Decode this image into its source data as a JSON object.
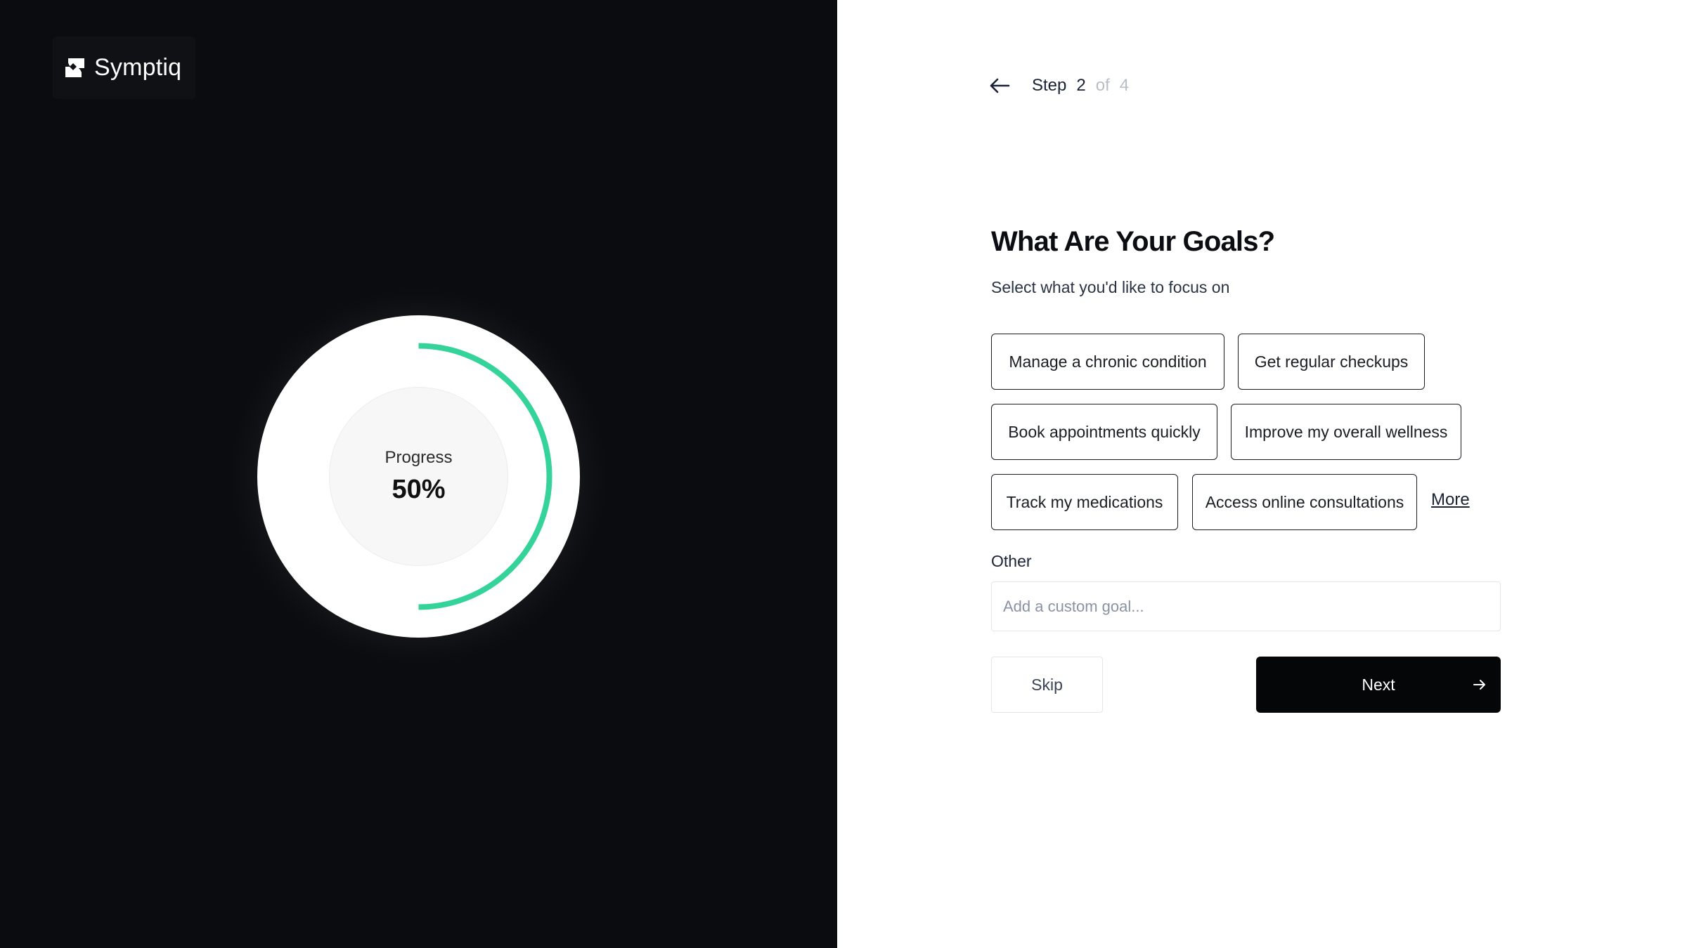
{
  "brand": {
    "name": "Symptiq"
  },
  "progress": {
    "label": "Progress",
    "value_text": "50%",
    "fraction": 0.5,
    "accent_color": "#34d399"
  },
  "stepper": {
    "word": "Step",
    "current": "2",
    "of": "of",
    "total": "4"
  },
  "form": {
    "title": "What Are Your Goals?",
    "subtitle": "Select what you'd like to focus on",
    "chips": [
      "Manage a chronic condition",
      "Get regular checkups",
      "Book appointments quickly",
      "Improve my overall wellness",
      "Track my medications",
      "Access online consultations"
    ],
    "more_label": "More",
    "other_label": "Other",
    "other_placeholder": "Add a custom goal...",
    "skip_label": "Skip",
    "next_label": "Next"
  },
  "icons": {
    "back": "arrow-left-icon",
    "next": "arrow-right-icon",
    "logo": "symptiq-logo-icon"
  }
}
